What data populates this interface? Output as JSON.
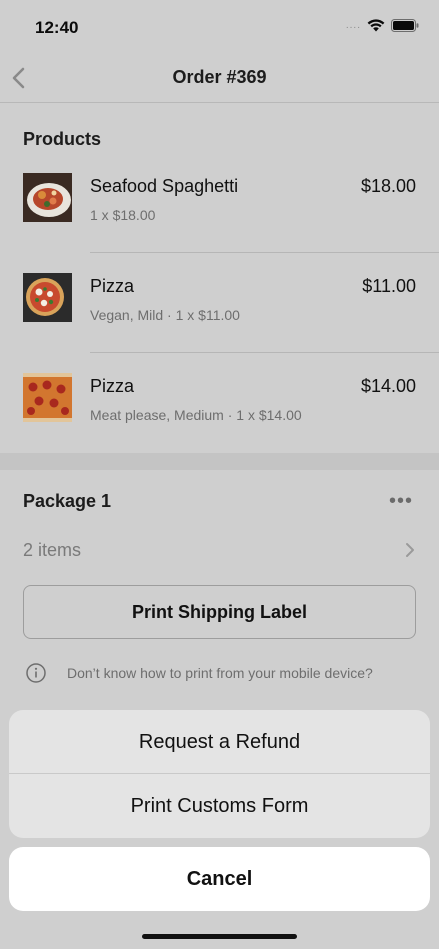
{
  "status_bar": {
    "time": "12:40",
    "signal": "....",
    "wifi_icon": "wifi-icon",
    "battery_icon": "battery-icon"
  },
  "nav": {
    "title": "Order #369",
    "back_icon": "chevron-left-icon"
  },
  "products": {
    "heading": "Products",
    "items": [
      {
        "name": "Seafood Spaghetti",
        "detail": "1 x $18.00",
        "price": "$18.00",
        "thumb": "seafood-spaghetti"
      },
      {
        "name": "Pizza",
        "detail": "Vegan, Mild · 1 x $11.00",
        "price": "$11.00",
        "thumb": "pizza-vegan"
      },
      {
        "name": "Pizza",
        "detail": "Meat please, Medium · 1 x $14.00",
        "price": "$14.00",
        "thumb": "pizza-meat"
      }
    ]
  },
  "package": {
    "title": "Package 1",
    "more": "•••",
    "items_label": "2 items",
    "print_label": "Print Shipping Label",
    "help_text": "Don’t know how to print from your mobile device?"
  },
  "action_sheet": {
    "options": [
      "Request a Refund",
      "Print Customs Form"
    ],
    "cancel": "Cancel"
  },
  "colors": {
    "overlay": "#cfcfcf",
    "sheet": "#e4e4e4",
    "cancel_bg": "#ffffff"
  }
}
